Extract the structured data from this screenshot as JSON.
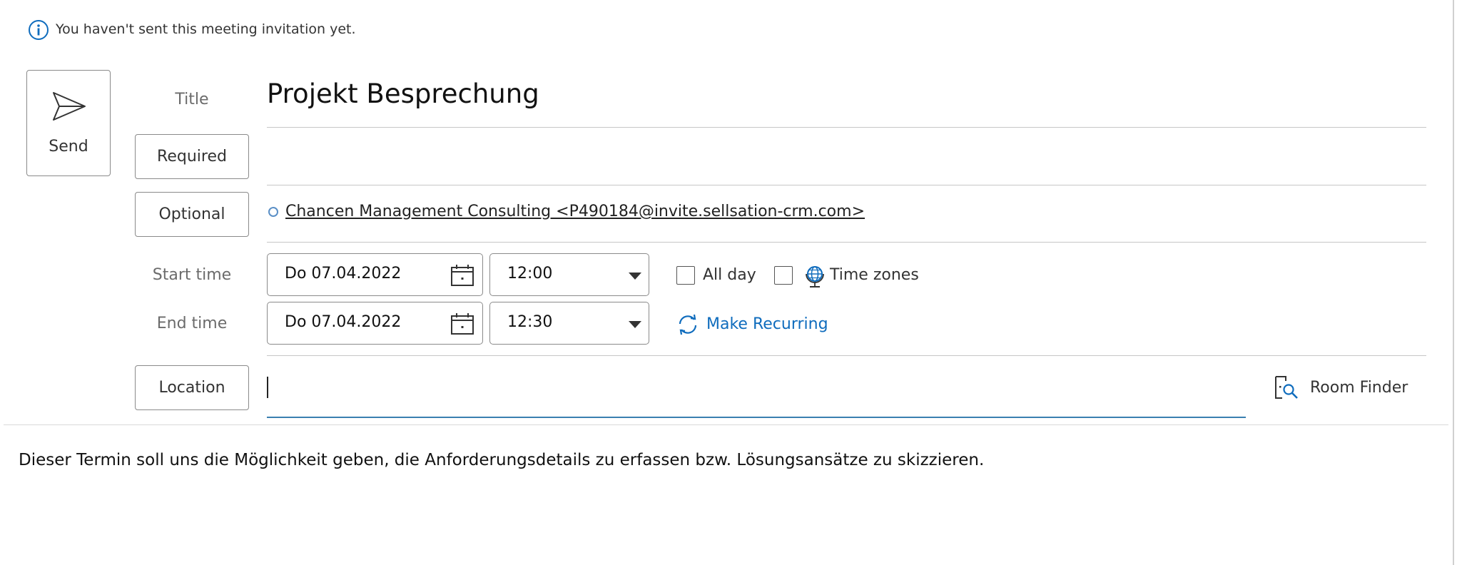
{
  "info_bar": {
    "icon": "info-icon",
    "message": "You haven't sent this meeting invitation yet."
  },
  "send_button": {
    "label": "Send",
    "icon": "send-icon"
  },
  "fields": {
    "title_label": "Title",
    "title_value": "Projekt Besprechung",
    "required_label": "Required",
    "optional_label": "Optional",
    "optional_attendee": "Chancen Management Consulting <P490184@invite.sellsation-crm.com>",
    "start_time_label": "Start time",
    "end_time_label": "End time",
    "start_date": "Do 07.04.2022",
    "start_time": "12:00",
    "end_date": "Do 07.04.2022",
    "end_time": "12:30",
    "location_label": "Location",
    "location_value": ""
  },
  "options": {
    "all_day_label": "All day",
    "all_day_checked": false,
    "time_zones_label": "Time zones",
    "time_zones_checked": false,
    "make_recurring_label": "Make Recurring",
    "room_finder_label": "Room Finder"
  },
  "body": {
    "text": "Dieser Termin soll uns die Möglichkeit geben, die Anforderungsdetails zu erfassen bzw. Lösungsansätze zu skizzieren."
  },
  "colors": {
    "accent": "#0f6cbd",
    "border": "#8a8a8a",
    "divider": "#c6c6c6",
    "location_underline": "#3a7fb0"
  }
}
